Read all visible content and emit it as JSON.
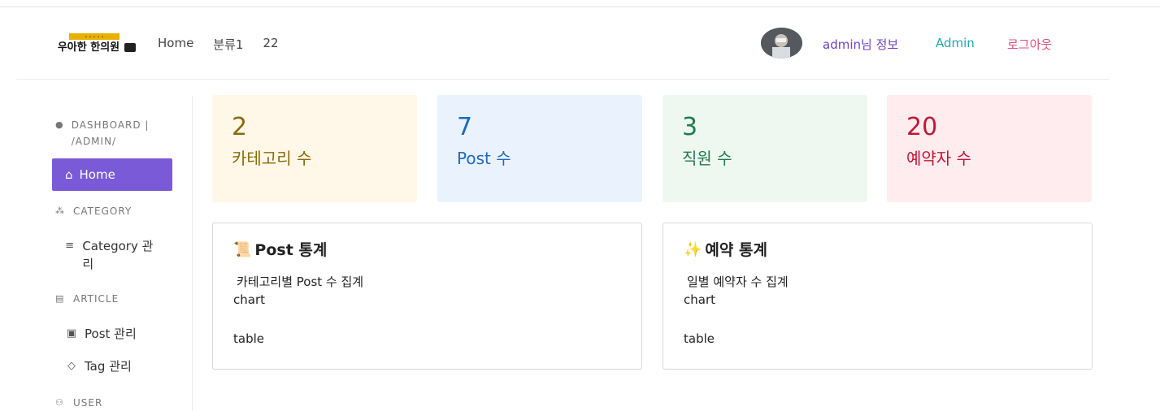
{
  "header": {
    "logo_alt": "우아한 한의원",
    "nav": [
      "Home",
      "분류1",
      "22"
    ],
    "user_info": "admin님 정보",
    "admin_link": "Admin",
    "logout": "로그아웃"
  },
  "sidebar": {
    "dashboard_section": "DASHBOARD | /ADMIN/",
    "home": "Home",
    "category_section": "CATEGORY",
    "category_item": "Category 관리",
    "article_section": "ARTICLE",
    "post_item": "Post 관리",
    "tag_item": "Tag 관리",
    "user_section": "USER"
  },
  "stats": [
    {
      "value": "2",
      "label": "카테고리 수",
      "color": "#8a6a0a",
      "bg": "#fff8e8"
    },
    {
      "value": "7",
      "label": "Post 수",
      "color": "#1e6bbf",
      "bg": "#eaf3fd"
    },
    {
      "value": "3",
      "label": "직원 수",
      "color": "#237a4e",
      "bg": "#eef8f1"
    },
    {
      "value": "20",
      "label": "예약자 수",
      "color": "#c01835",
      "bg": "#ffecef"
    }
  ],
  "panels": [
    {
      "emoji": "📜",
      "title": "Post 통계",
      "subtitle": "카테고리별 Post 수 집계",
      "chart": "chart",
      "table": "table"
    },
    {
      "emoji": "✨",
      "title": "예약 통계",
      "subtitle": "일별 예약자 수 집계",
      "chart": "chart",
      "table": "table"
    }
  ],
  "colors": {
    "accent": "#7a5ad6"
  }
}
